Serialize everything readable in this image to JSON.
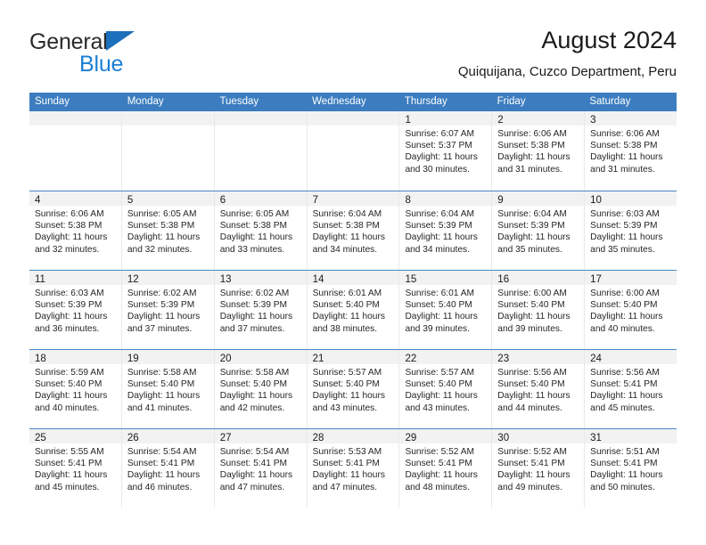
{
  "brand": {
    "name_part1": "General",
    "name_part2": "Blue",
    "triangle_color": "#1c6fba",
    "blue_text_color": "#1b7fd4"
  },
  "header": {
    "title": "August 2024",
    "subtitle": "Quiquijana, Cuzco Department, Peru"
  },
  "calendar": {
    "accent_color": "#3c7dbf",
    "daynum_band_color": "#f2f2f2",
    "weekday_headers": [
      "Sunday",
      "Monday",
      "Tuesday",
      "Wednesday",
      "Thursday",
      "Friday",
      "Saturday"
    ],
    "weeks": [
      [
        {
          "day": "",
          "sunrise": "",
          "sunset": "",
          "daylight_line1": "",
          "daylight_line2": ""
        },
        {
          "day": "",
          "sunrise": "",
          "sunset": "",
          "daylight_line1": "",
          "daylight_line2": ""
        },
        {
          "day": "",
          "sunrise": "",
          "sunset": "",
          "daylight_line1": "",
          "daylight_line2": ""
        },
        {
          "day": "",
          "sunrise": "",
          "sunset": "",
          "daylight_line1": "",
          "daylight_line2": ""
        },
        {
          "day": "1",
          "sunrise": "Sunrise: 6:07 AM",
          "sunset": "Sunset: 5:37 PM",
          "daylight_line1": "Daylight: 11 hours",
          "daylight_line2": "and 30 minutes."
        },
        {
          "day": "2",
          "sunrise": "Sunrise: 6:06 AM",
          "sunset": "Sunset: 5:38 PM",
          "daylight_line1": "Daylight: 11 hours",
          "daylight_line2": "and 31 minutes."
        },
        {
          "day": "3",
          "sunrise": "Sunrise: 6:06 AM",
          "sunset": "Sunset: 5:38 PM",
          "daylight_line1": "Daylight: 11 hours",
          "daylight_line2": "and 31 minutes."
        }
      ],
      [
        {
          "day": "4",
          "sunrise": "Sunrise: 6:06 AM",
          "sunset": "Sunset: 5:38 PM",
          "daylight_line1": "Daylight: 11 hours",
          "daylight_line2": "and 32 minutes."
        },
        {
          "day": "5",
          "sunrise": "Sunrise: 6:05 AM",
          "sunset": "Sunset: 5:38 PM",
          "daylight_line1": "Daylight: 11 hours",
          "daylight_line2": "and 32 minutes."
        },
        {
          "day": "6",
          "sunrise": "Sunrise: 6:05 AM",
          "sunset": "Sunset: 5:38 PM",
          "daylight_line1": "Daylight: 11 hours",
          "daylight_line2": "and 33 minutes."
        },
        {
          "day": "7",
          "sunrise": "Sunrise: 6:04 AM",
          "sunset": "Sunset: 5:38 PM",
          "daylight_line1": "Daylight: 11 hours",
          "daylight_line2": "and 34 minutes."
        },
        {
          "day": "8",
          "sunrise": "Sunrise: 6:04 AM",
          "sunset": "Sunset: 5:39 PM",
          "daylight_line1": "Daylight: 11 hours",
          "daylight_line2": "and 34 minutes."
        },
        {
          "day": "9",
          "sunrise": "Sunrise: 6:04 AM",
          "sunset": "Sunset: 5:39 PM",
          "daylight_line1": "Daylight: 11 hours",
          "daylight_line2": "and 35 minutes."
        },
        {
          "day": "10",
          "sunrise": "Sunrise: 6:03 AM",
          "sunset": "Sunset: 5:39 PM",
          "daylight_line1": "Daylight: 11 hours",
          "daylight_line2": "and 35 minutes."
        }
      ],
      [
        {
          "day": "11",
          "sunrise": "Sunrise: 6:03 AM",
          "sunset": "Sunset: 5:39 PM",
          "daylight_line1": "Daylight: 11 hours",
          "daylight_line2": "and 36 minutes."
        },
        {
          "day": "12",
          "sunrise": "Sunrise: 6:02 AM",
          "sunset": "Sunset: 5:39 PM",
          "daylight_line1": "Daylight: 11 hours",
          "daylight_line2": "and 37 minutes."
        },
        {
          "day": "13",
          "sunrise": "Sunrise: 6:02 AM",
          "sunset": "Sunset: 5:39 PM",
          "daylight_line1": "Daylight: 11 hours",
          "daylight_line2": "and 37 minutes."
        },
        {
          "day": "14",
          "sunrise": "Sunrise: 6:01 AM",
          "sunset": "Sunset: 5:40 PM",
          "daylight_line1": "Daylight: 11 hours",
          "daylight_line2": "and 38 minutes."
        },
        {
          "day": "15",
          "sunrise": "Sunrise: 6:01 AM",
          "sunset": "Sunset: 5:40 PM",
          "daylight_line1": "Daylight: 11 hours",
          "daylight_line2": "and 39 minutes."
        },
        {
          "day": "16",
          "sunrise": "Sunrise: 6:00 AM",
          "sunset": "Sunset: 5:40 PM",
          "daylight_line1": "Daylight: 11 hours",
          "daylight_line2": "and 39 minutes."
        },
        {
          "day": "17",
          "sunrise": "Sunrise: 6:00 AM",
          "sunset": "Sunset: 5:40 PM",
          "daylight_line1": "Daylight: 11 hours",
          "daylight_line2": "and 40 minutes."
        }
      ],
      [
        {
          "day": "18",
          "sunrise": "Sunrise: 5:59 AM",
          "sunset": "Sunset: 5:40 PM",
          "daylight_line1": "Daylight: 11 hours",
          "daylight_line2": "and 40 minutes."
        },
        {
          "day": "19",
          "sunrise": "Sunrise: 5:58 AM",
          "sunset": "Sunset: 5:40 PM",
          "daylight_line1": "Daylight: 11 hours",
          "daylight_line2": "and 41 minutes."
        },
        {
          "day": "20",
          "sunrise": "Sunrise: 5:58 AM",
          "sunset": "Sunset: 5:40 PM",
          "daylight_line1": "Daylight: 11 hours",
          "daylight_line2": "and 42 minutes."
        },
        {
          "day": "21",
          "sunrise": "Sunrise: 5:57 AM",
          "sunset": "Sunset: 5:40 PM",
          "daylight_line1": "Daylight: 11 hours",
          "daylight_line2": "and 43 minutes."
        },
        {
          "day": "22",
          "sunrise": "Sunrise: 5:57 AM",
          "sunset": "Sunset: 5:40 PM",
          "daylight_line1": "Daylight: 11 hours",
          "daylight_line2": "and 43 minutes."
        },
        {
          "day": "23",
          "sunrise": "Sunrise: 5:56 AM",
          "sunset": "Sunset: 5:40 PM",
          "daylight_line1": "Daylight: 11 hours",
          "daylight_line2": "and 44 minutes."
        },
        {
          "day": "24",
          "sunrise": "Sunrise: 5:56 AM",
          "sunset": "Sunset: 5:41 PM",
          "daylight_line1": "Daylight: 11 hours",
          "daylight_line2": "and 45 minutes."
        }
      ],
      [
        {
          "day": "25",
          "sunrise": "Sunrise: 5:55 AM",
          "sunset": "Sunset: 5:41 PM",
          "daylight_line1": "Daylight: 11 hours",
          "daylight_line2": "and 45 minutes."
        },
        {
          "day": "26",
          "sunrise": "Sunrise: 5:54 AM",
          "sunset": "Sunset: 5:41 PM",
          "daylight_line1": "Daylight: 11 hours",
          "daylight_line2": "and 46 minutes."
        },
        {
          "day": "27",
          "sunrise": "Sunrise: 5:54 AM",
          "sunset": "Sunset: 5:41 PM",
          "daylight_line1": "Daylight: 11 hours",
          "daylight_line2": "and 47 minutes."
        },
        {
          "day": "28",
          "sunrise": "Sunrise: 5:53 AM",
          "sunset": "Sunset: 5:41 PM",
          "daylight_line1": "Daylight: 11 hours",
          "daylight_line2": "and 47 minutes."
        },
        {
          "day": "29",
          "sunrise": "Sunrise: 5:52 AM",
          "sunset": "Sunset: 5:41 PM",
          "daylight_line1": "Daylight: 11 hours",
          "daylight_line2": "and 48 minutes."
        },
        {
          "day": "30",
          "sunrise": "Sunrise: 5:52 AM",
          "sunset": "Sunset: 5:41 PM",
          "daylight_line1": "Daylight: 11 hours",
          "daylight_line2": "and 49 minutes."
        },
        {
          "day": "31",
          "sunrise": "Sunrise: 5:51 AM",
          "sunset": "Sunset: 5:41 PM",
          "daylight_line1": "Daylight: 11 hours",
          "daylight_line2": "and 50 minutes."
        }
      ]
    ]
  }
}
